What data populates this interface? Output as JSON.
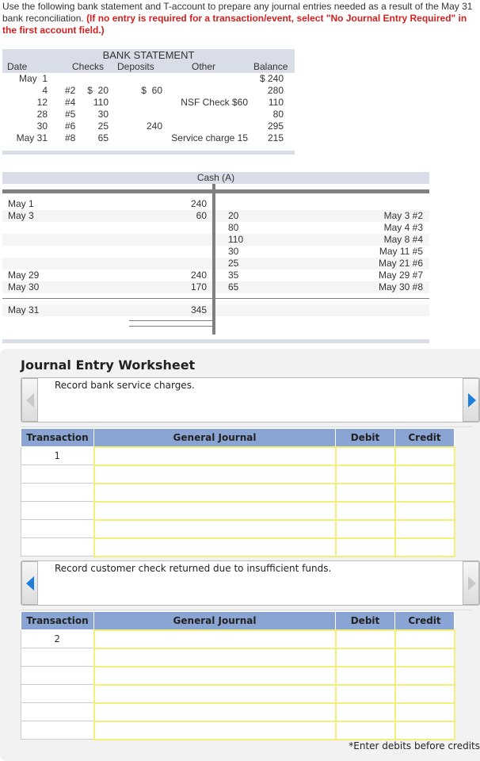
{
  "intro": {
    "text": "Use the following bank statement and T-account to prepare any journal entries needed as a result of the May 31 bank reconciliation. ",
    "highlight": "(If no entry is required for a transaction/event, select \"No Journal Entry Required\" in the first account field.)"
  },
  "bank_statement": {
    "title": "BANK STATEMENT",
    "headers": [
      "Date",
      "Checks",
      "Deposits",
      "Other",
      "Balance"
    ],
    "rows": [
      {
        "date": "May  1",
        "check_no": "",
        "check_amt": "",
        "deposit": "",
        "other": "",
        "balance": "$ 240"
      },
      {
        "date": "4",
        "check_no": "#2",
        "check_amt": "$  20",
        "deposit": "$  60",
        "other": "",
        "balance": "280"
      },
      {
        "date": "12",
        "check_no": "#4",
        "check_amt": "110",
        "deposit": "",
        "other": "NSF Check $60",
        "balance": "110"
      },
      {
        "date": "28",
        "check_no": "#5",
        "check_amt": "30",
        "deposit": "",
        "other": "",
        "balance": "80"
      },
      {
        "date": "30",
        "check_no": "#6",
        "check_amt": "25",
        "deposit": "240",
        "other": "",
        "balance": "295"
      },
      {
        "date": "May 31",
        "check_no": "#8",
        "check_amt": "65",
        "deposit": "",
        "other": "Service charge 15",
        "balance": "215"
      }
    ]
  },
  "t_account": {
    "title": "Cash (A)",
    "rows": [
      {
        "ldate": "May 1",
        "lamt": "240",
        "ramt": "",
        "rdate": ""
      },
      {
        "ldate": "May 3",
        "lamt": "60",
        "ramt": "20",
        "rdate": "May 3 #2"
      },
      {
        "ldate": "",
        "lamt": "",
        "ramt": "80",
        "rdate": "May 4 #3"
      },
      {
        "ldate": "",
        "lamt": "",
        "ramt": "110",
        "rdate": "May 8 #4"
      },
      {
        "ldate": "",
        "lamt": "",
        "ramt": "30",
        "rdate": "May 11 #5"
      },
      {
        "ldate": "",
        "lamt": "",
        "ramt": "25",
        "rdate": "May 21 #6"
      },
      {
        "ldate": "May 29",
        "lamt": "240",
        "ramt": "35",
        "rdate": "May 29 #7"
      },
      {
        "ldate": "May 30",
        "lamt": "170",
        "ramt": "65",
        "rdate": "May 30 #8"
      }
    ],
    "ending": {
      "date": "May 31",
      "amount": "345"
    }
  },
  "worksheet": {
    "title": "Journal Entry Worksheet",
    "headers": [
      "Transaction",
      "General Journal",
      "Debit",
      "Credit"
    ],
    "entries": [
      {
        "description": "Record bank service charges.",
        "transaction": "1"
      },
      {
        "description": "Record customer check returned due to insufficient funds.",
        "transaction": "2"
      }
    ],
    "footnote": "*Enter debits before credits"
  },
  "colors": {
    "header_blue": "#8aa4d4",
    "input_border": "#f3f07a",
    "highlight_red": "#d02020",
    "arrow_active": "#1e7fd8"
  }
}
